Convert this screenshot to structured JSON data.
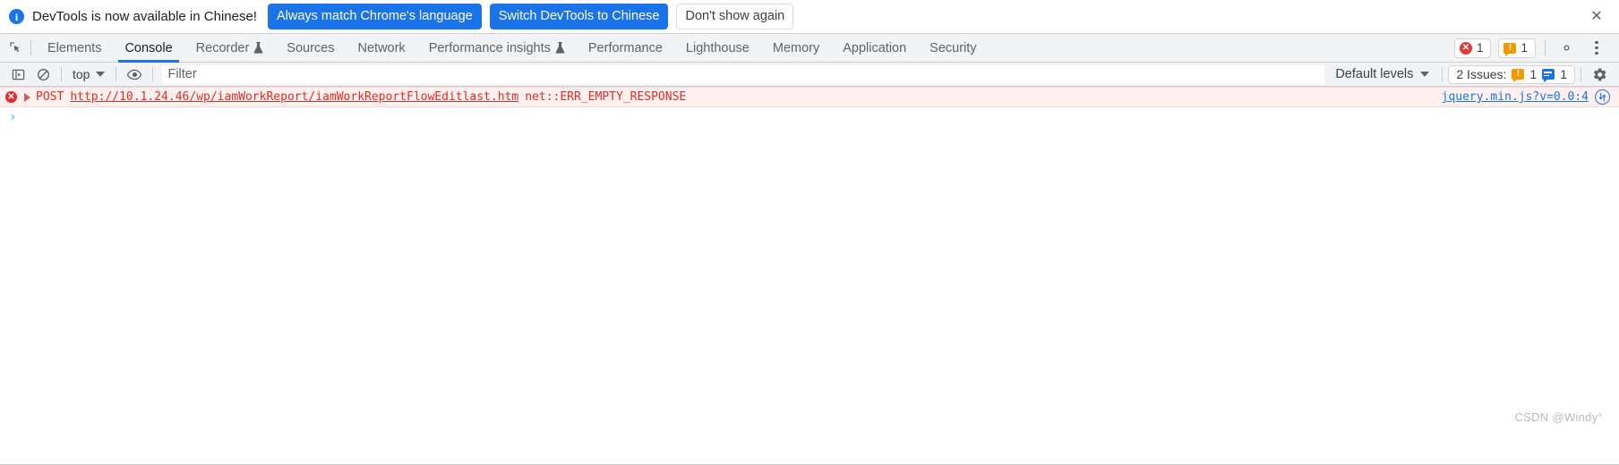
{
  "banner": {
    "icon": "info-icon",
    "message": "DevTools is now available in Chinese!",
    "primary_button": "Always match Chrome's language",
    "secondary_button": "Switch DevTools to Chinese",
    "dismiss_button": "Don't show again",
    "close_icon": "close-icon",
    "close_glyph": "✕",
    "accent_color": "#1a73e8"
  },
  "tabbar": {
    "inspect_icon": "inspect-element-icon",
    "tabs": [
      {
        "label": "Elements",
        "active": false,
        "flask": false
      },
      {
        "label": "Console",
        "active": true,
        "flask": false
      },
      {
        "label": "Recorder",
        "active": false,
        "flask": true
      },
      {
        "label": "Sources",
        "active": false,
        "flask": false
      },
      {
        "label": "Network",
        "active": false,
        "flask": false
      },
      {
        "label": "Performance insights",
        "active": false,
        "flask": true
      },
      {
        "label": "Performance",
        "active": false,
        "flask": false
      },
      {
        "label": "Lighthouse",
        "active": false,
        "flask": false
      },
      {
        "label": "Memory",
        "active": false,
        "flask": false
      },
      {
        "label": "Application",
        "active": false,
        "flask": false
      },
      {
        "label": "Security",
        "active": false,
        "flask": false
      }
    ],
    "error_count": "1",
    "warning_count": "1",
    "error_glyph": "✕",
    "warning_glyph": "!",
    "settings_icon": "gear-icon",
    "more_icon": "more-options-icon",
    "active_underline_color": "#1a73e8",
    "error_color": "#e53935",
    "warning_color": "#f29900"
  },
  "console_toolbar": {
    "sidebar_toggle_icon": "console-sidebar-icon",
    "clear_icon": "clear-console-icon",
    "context": "top",
    "eye_icon": "live-expression-eye-icon",
    "filter_value": "",
    "filter_placeholder": "Filter",
    "levels": "Default levels",
    "issues_label": "2 Issues:",
    "issues_warning_count": "1",
    "issues_info_count": "1",
    "settings_icon": "console-settings-gear-icon"
  },
  "console": {
    "messages": [
      {
        "severity": "error",
        "severity_glyph": "✕",
        "method": "POST",
        "url": "http://10.1.24.46/wp/iamWorkReport/iamWorkReportFlowEditlast.htm",
        "status": "net::ERR_EMPTY_RESPONSE",
        "source": "jquery.min.js?v=0.0:4",
        "network_icon": "network-request-icon"
      }
    ],
    "prompt_chevron": "›",
    "prompt_value": "",
    "error_bg": "#fff0f0",
    "error_text_color": "#d93025"
  },
  "watermark": {
    "text": "CSDN @Windy°"
  }
}
